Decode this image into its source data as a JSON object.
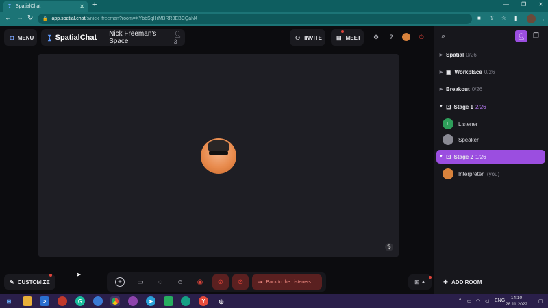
{
  "browser": {
    "tab_title": "SpatialChat",
    "tab_close": "✕",
    "new_tab": "+",
    "url_host": "app.spatial.chat",
    "url_path": "/s/nick_freeman?room=XYbbSgHrMBRR3EBCQaN4"
  },
  "header": {
    "menu_label": "MENU",
    "brand": "SpatialChat",
    "space_name": "Nick Freeman's Space",
    "people_count": "3",
    "invite_label": "INVITE",
    "meet_label": "MEET"
  },
  "panel": {
    "rooms": [
      {
        "name": "Spatial",
        "count": "0/26"
      },
      {
        "name": "Workplace",
        "count": "0/26"
      },
      {
        "name": "Breakout",
        "count": "0/26"
      },
      {
        "name": "Stage 1",
        "count": "2/26"
      },
      {
        "name": "Stage 2",
        "count": "1/26"
      }
    ],
    "members": [
      {
        "name": "Listener",
        "initial": "L"
      },
      {
        "name": "Speaker"
      },
      {
        "name": "Interpreter",
        "you": "(you)"
      }
    ],
    "add_room": "ADD ROOM"
  },
  "bottom": {
    "customize": "CUSTOMIZE",
    "back_to_listeners": "Back to the Listeners"
  },
  "taskbar": {
    "lang": "ENG",
    "time": "14:10",
    "date": "28.11.2022"
  },
  "colors": {
    "accent": "#9b4ee0",
    "danger": "#e0443a",
    "listener_green": "#2e9e5a"
  }
}
